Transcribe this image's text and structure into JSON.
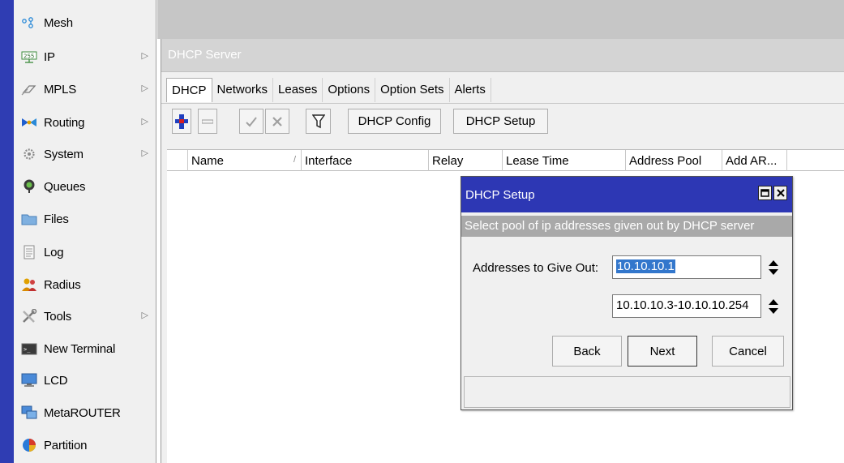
{
  "sidebar": {
    "items": [
      {
        "label": "Mesh",
        "icon": "mesh-icon"
      },
      {
        "label": "IP",
        "icon": "ip-icon",
        "submenu": true
      },
      {
        "label": "MPLS",
        "icon": "mpls-icon",
        "submenu": true
      },
      {
        "label": "Routing",
        "icon": "routing-icon",
        "submenu": true
      },
      {
        "label": "System",
        "icon": "system-icon",
        "submenu": true
      },
      {
        "label": "Queues",
        "icon": "queues-icon"
      },
      {
        "label": "Files",
        "icon": "files-icon"
      },
      {
        "label": "Log",
        "icon": "log-icon"
      },
      {
        "label": "Radius",
        "icon": "radius-icon"
      },
      {
        "label": "Tools",
        "icon": "tools-icon",
        "submenu": true
      },
      {
        "label": "New Terminal",
        "icon": "terminal-icon"
      },
      {
        "label": "LCD",
        "icon": "lcd-icon"
      },
      {
        "label": "MetaROUTER",
        "icon": "metarouter-icon"
      },
      {
        "label": "Partition",
        "icon": "partition-icon"
      }
    ],
    "arrow": "▷"
  },
  "dhcp_window": {
    "title": "DHCP Server",
    "tabs": [
      "DHCP",
      "Networks",
      "Leases",
      "Options",
      "Option Sets",
      "Alerts"
    ],
    "active_tab": "DHCP",
    "toolbar": {
      "config_label": "DHCP Config",
      "setup_label": "DHCP Setup"
    },
    "columns": [
      "Name",
      "Interface",
      "Relay",
      "Lease Time",
      "Address Pool",
      "Add AR..."
    ],
    "sort_marker": "/"
  },
  "dialog": {
    "title": "DHCP Setup",
    "hint": "Select pool of ip addresses given out by DHCP server",
    "field_label": "Addresses to Give Out:",
    "address_1": "10.10.10.1",
    "address_2": "10.10.10.3-10.10.10.254",
    "back_label": "Back",
    "next_label": "Next",
    "cancel_label": "Cancel",
    "status": ""
  },
  "colors": {
    "accent_blue": "#2d37b4",
    "hint_grey": "#a9a9a9",
    "selection_blue": "#3377cc",
    "add_icon_blue": "#1f3fbf",
    "add_icon_red": "#d81f1f"
  }
}
